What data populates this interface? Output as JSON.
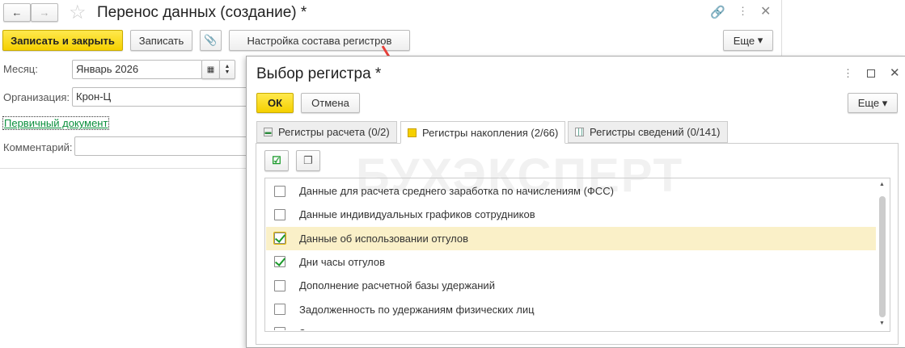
{
  "main": {
    "title": "Перенос данных (создание) *",
    "save_close": "Записать и закрыть",
    "save": "Записать",
    "settings": "Настройка состава регистров",
    "more": "Еще",
    "month_label": "Месяц:",
    "month_value": "Январь 2026",
    "org_label": "Организация:",
    "org_value": "Крон-Ц",
    "primary_doc": "Первичный документ",
    "comment_label": "Комментарий:",
    "comment_value": ""
  },
  "dialog": {
    "title": "Выбор регистра *",
    "ok": "ОК",
    "cancel": "Отмена",
    "more": "Еще",
    "tabs": [
      {
        "label": "Регистры расчета (0/2)"
      },
      {
        "label": "Регистры накопления (2/66)"
      },
      {
        "label": "Регистры сведений (0/141)"
      }
    ],
    "active_tab": 1,
    "watermark": "БУХЭКСПЕРТ",
    "rows": [
      {
        "label": "Данные для расчета среднего заработка по начислениям (ФСС)",
        "checked": false
      },
      {
        "label": "Данные индивидуальных графиков сотрудников",
        "checked": false
      },
      {
        "label": "Данные об использовании отгулов",
        "checked": true,
        "selected": true
      },
      {
        "label": "Дни часы отгулов",
        "checked": true
      },
      {
        "label": "Дополнение расчетной базы удержаний",
        "checked": false
      },
      {
        "label": "Задолженность по удержаниям физических лиц",
        "checked": false
      },
      {
        "label": "Зарплата к выплате",
        "checked": false
      }
    ]
  },
  "colors": {
    "accent": "#f5d000",
    "link": "#0a8f3c",
    "arrow": "#e8403a"
  }
}
